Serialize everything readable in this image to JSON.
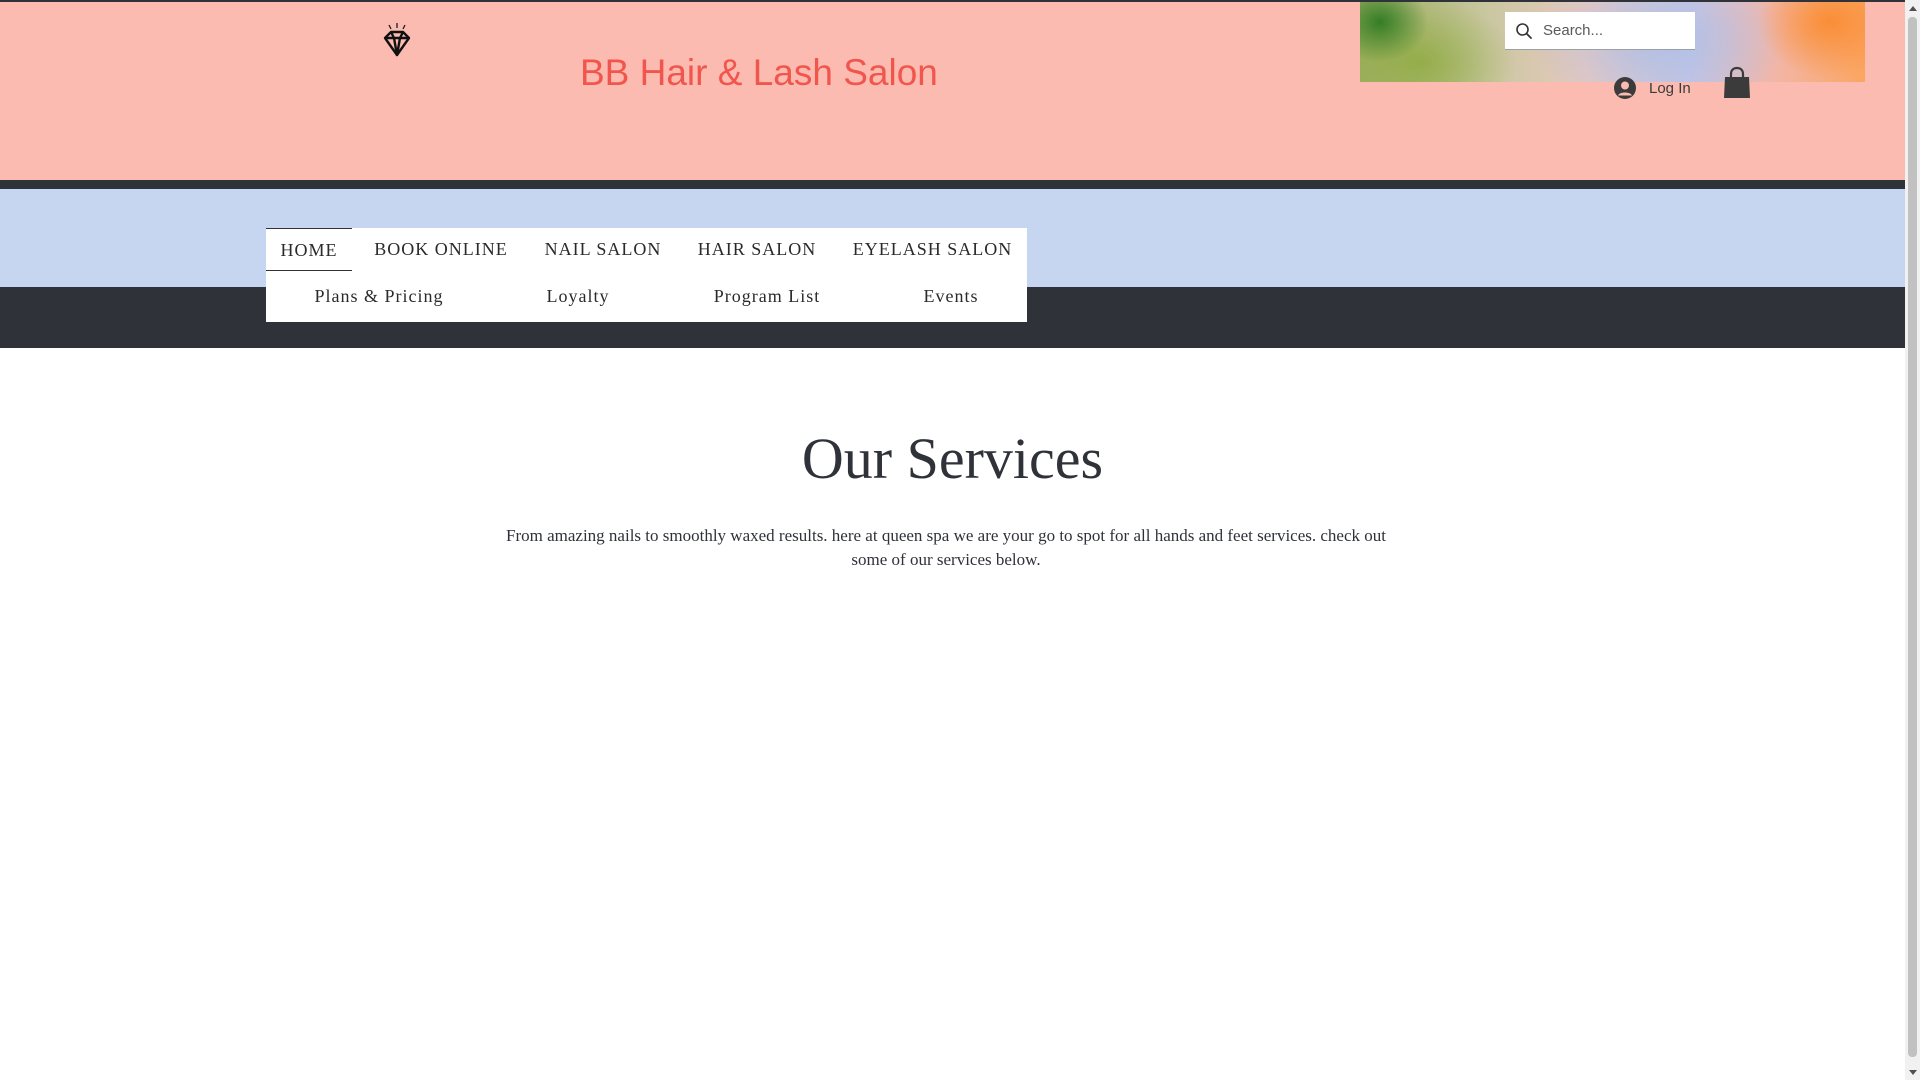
{
  "header": {
    "site_title": "BB Hair & Lash Salon",
    "logo_icon": "diamond-icon",
    "search": {
      "placeholder": "Search..."
    },
    "login_label": "Log In",
    "cart_icon": "shopping-bag-icon"
  },
  "nav": {
    "row1": [
      {
        "label": "HOME",
        "active": true
      },
      {
        "label": "BOOK ONLINE",
        "active": false
      },
      {
        "label": "NAIL SALON",
        "active": false
      },
      {
        "label": "HAIR SALON",
        "active": false
      },
      {
        "label": "EYELASH SALON",
        "active": false
      }
    ],
    "row2": [
      {
        "label": "Plans & Pricing"
      },
      {
        "label": "Loyalty"
      },
      {
        "label": "Program List"
      },
      {
        "label": "Events"
      }
    ]
  },
  "main": {
    "section_title": "Our Services",
    "description_line1": "From amazing nails to smoothly waxed results. here at queen spa we are your go to spot for all hands and feet services. check out",
    "description_line2": "some of our services below."
  },
  "colors": {
    "header_bg": "#fbbbb1",
    "title_color": "#f1564d",
    "nav_band": "#c7d6f0",
    "dark": "#2f3239"
  }
}
